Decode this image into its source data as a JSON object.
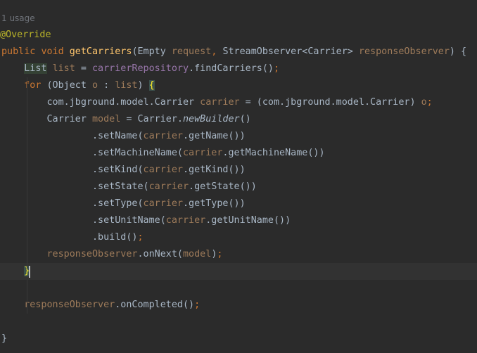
{
  "editor": {
    "usage_hint": "1 usage",
    "annotation": "@Override",
    "lines": [
      {
        "tokens": [
          {
            "t": "public",
            "c": "kw"
          },
          {
            "t": " ",
            "c": "plain"
          },
          {
            "t": "void",
            "c": "kw"
          },
          {
            "t": " ",
            "c": "plain"
          },
          {
            "t": "getCarriers",
            "c": "method-decl"
          },
          {
            "t": "(Empty ",
            "c": "plain"
          },
          {
            "t": "request",
            "c": "param-unused"
          },
          {
            "t": ", ",
            "c": "punct"
          },
          {
            "t": "StreamObserver<Carrier> ",
            "c": "plain"
          },
          {
            "t": "responseObserver",
            "c": "param-unused"
          },
          {
            "t": ") {",
            "c": "plain"
          }
        ]
      },
      {
        "tokens": [
          {
            "t": "    ",
            "c": "plain"
          },
          {
            "t": "List",
            "c": "type-hl"
          },
          {
            "t": " ",
            "c": "plain"
          },
          {
            "t": "list",
            "c": "local-unused"
          },
          {
            "t": " = ",
            "c": "plain"
          },
          {
            "t": "carrierRepository",
            "c": "field"
          },
          {
            "t": ".findCarriers()",
            "c": "plain"
          },
          {
            "t": ";",
            "c": "punct"
          }
        ]
      },
      {
        "tokens": [
          {
            "t": "    ",
            "c": "plain"
          },
          {
            "t": "for",
            "c": "kw"
          },
          {
            "t": " (Object ",
            "c": "plain"
          },
          {
            "t": "o",
            "c": "local-unused"
          },
          {
            "t": " : ",
            "c": "plain"
          },
          {
            "t": "list",
            "c": "local-unused"
          },
          {
            "t": ") ",
            "c": "plain"
          },
          {
            "t": "{",
            "c": "brace-match"
          }
        ]
      },
      {
        "tokens": [
          {
            "t": "        com.jbground.model.Carrier ",
            "c": "plain"
          },
          {
            "t": "carrier",
            "c": "local-unused"
          },
          {
            "t": " = (com.jbground.model.Carrier) ",
            "c": "plain"
          },
          {
            "t": "o",
            "c": "local-unused"
          },
          {
            "t": ";",
            "c": "punct"
          }
        ]
      },
      {
        "tokens": [
          {
            "t": "        Carrier ",
            "c": "plain"
          },
          {
            "t": "model",
            "c": "local-unused"
          },
          {
            "t": " = Carrier.",
            "c": "plain"
          },
          {
            "t": "newBuilder",
            "c": "static-call"
          },
          {
            "t": "()",
            "c": "plain"
          }
        ]
      },
      {
        "tokens": [
          {
            "t": "                .setName(",
            "c": "plain"
          },
          {
            "t": "carrier",
            "c": "local-unused"
          },
          {
            "t": ".getName())",
            "c": "plain"
          }
        ]
      },
      {
        "tokens": [
          {
            "t": "                .setMachineName(",
            "c": "plain"
          },
          {
            "t": "carrier",
            "c": "local-unused"
          },
          {
            "t": ".getMachineName())",
            "c": "plain"
          }
        ]
      },
      {
        "tokens": [
          {
            "t": "                .setKind(",
            "c": "plain"
          },
          {
            "t": "carrier",
            "c": "local-unused"
          },
          {
            "t": ".getKind())",
            "c": "plain"
          }
        ]
      },
      {
        "tokens": [
          {
            "t": "                .setState(",
            "c": "plain"
          },
          {
            "t": "carrier",
            "c": "local-unused"
          },
          {
            "t": ".getState())",
            "c": "plain"
          }
        ]
      },
      {
        "tokens": [
          {
            "t": "                .setType(",
            "c": "plain"
          },
          {
            "t": "carrier",
            "c": "local-unused"
          },
          {
            "t": ".getType())",
            "c": "plain"
          }
        ]
      },
      {
        "tokens": [
          {
            "t": "                .setUnitName(",
            "c": "plain"
          },
          {
            "t": "carrier",
            "c": "local-unused"
          },
          {
            "t": ".getUnitName())",
            "c": "plain"
          }
        ]
      },
      {
        "tokens": [
          {
            "t": "                .build()",
            "c": "plain"
          },
          {
            "t": ";",
            "c": "punct"
          }
        ]
      },
      {
        "tokens": [
          {
            "t": "        ",
            "c": "plain"
          },
          {
            "t": "responseObserver",
            "c": "param-unused"
          },
          {
            "t": ".onNext(",
            "c": "plain"
          },
          {
            "t": "model",
            "c": "local-unused"
          },
          {
            "t": ")",
            "c": "plain"
          },
          {
            "t": ";",
            "c": "punct"
          }
        ]
      },
      {
        "current": true,
        "tokens": [
          {
            "t": "    ",
            "c": "plain"
          },
          {
            "t": "}",
            "c": "brace-match"
          }
        ]
      },
      {
        "tokens": []
      },
      {
        "tokens": [
          {
            "t": "    ",
            "c": "plain"
          },
          {
            "t": "responseObserver",
            "c": "param-unused"
          },
          {
            "t": ".onCompleted()",
            "c": "plain"
          },
          {
            "t": ";",
            "c": "punct"
          }
        ]
      },
      {
        "tokens": []
      },
      {
        "tokens": [
          {
            "t": "}",
            "c": "plain"
          }
        ]
      }
    ]
  },
  "colors": {
    "background": "#2b2b2b",
    "current_line": "#323232",
    "keyword": "#cc7832",
    "method_declaration": "#ffc66d",
    "annotation": "#bbb529",
    "field": "#9876aa",
    "unused_identifier": "#9e7b5a",
    "default_text": "#a9b7c6"
  }
}
